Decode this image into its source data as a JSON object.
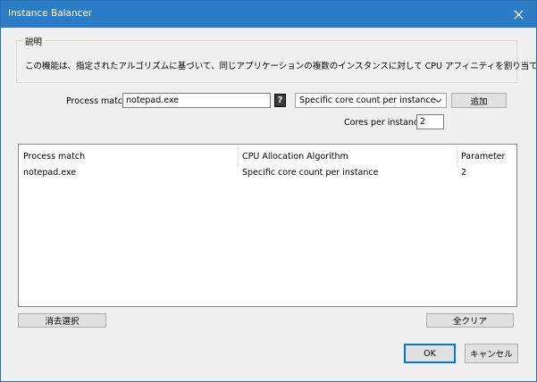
{
  "window": {
    "title": "Instance Balancer"
  },
  "description_group": {
    "title": "説明",
    "text": "この機能は、指定されたアルゴリズムに基づいて、同じアプリケーションの複数のインスタンスに対して CPU アフィニティを割り当てます。"
  },
  "form": {
    "process_match_label": "Process match:",
    "process_match_value": "notepad.exe",
    "help_label": "?",
    "algorithm_selected": "Specific core count per instance",
    "add_label": "追加",
    "cores_label": "Cores per instance:",
    "cores_value": "2"
  },
  "table": {
    "columns": [
      "Process match",
      "CPU Allocation Algorithm",
      "Parameter"
    ],
    "rows": [
      [
        "notepad.exe",
        "Specific core count per instance",
        "2"
      ]
    ]
  },
  "buttons": {
    "remove_selected": "消去選択",
    "clear_all": "全クリア",
    "ok": "OK",
    "cancel": "キャンセル"
  },
  "icons": {
    "close": "close-icon",
    "dropdown": "chevron-down-icon",
    "help": "help-icon"
  },
  "colors": {
    "titlebar": "#2b7bc6",
    "accent": "#0078d7"
  }
}
